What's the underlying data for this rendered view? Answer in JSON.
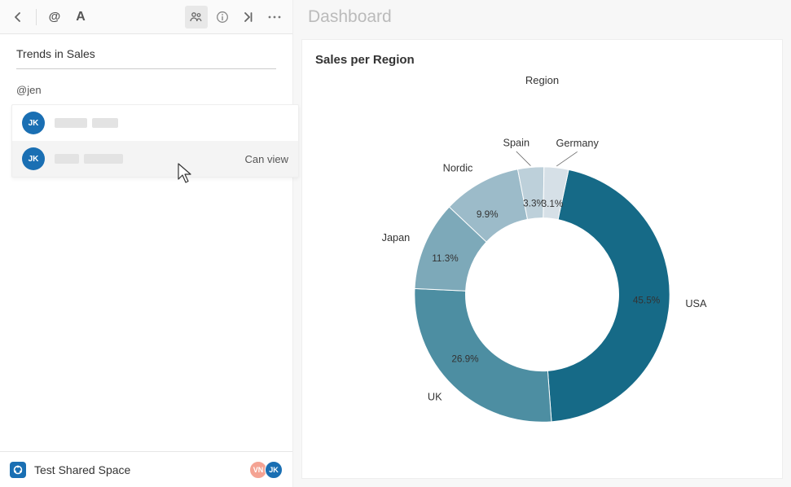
{
  "left": {
    "section_title": "Trends in Sales",
    "mention_text": "@jen",
    "suggestions": [
      {
        "initials": "JK",
        "permission": ""
      },
      {
        "initials": "JK",
        "permission": "Can view"
      }
    ]
  },
  "footer": {
    "space_name": "Test Shared Space",
    "avatars": [
      {
        "initials": "VN",
        "klass": "vn"
      },
      {
        "initials": "JK",
        "klass": "jk"
      }
    ]
  },
  "right": {
    "header": "Dashboard",
    "chart_title": "Sales per Region",
    "legend_title": "Region"
  },
  "chart_data": {
    "type": "pie",
    "title": "Sales per Region",
    "legend_title": "Region",
    "series": [
      {
        "name": "USA",
        "value": 45.5,
        "color": "#166a87"
      },
      {
        "name": "UK",
        "value": 26.9,
        "color": "#4d8ea2"
      },
      {
        "name": "Japan",
        "value": 11.3,
        "color": "#7da9b9"
      },
      {
        "name": "Nordic",
        "value": 9.9,
        "color": "#9cbbc9"
      },
      {
        "name": "Spain",
        "value": 3.3,
        "color": "#bdd0da"
      },
      {
        "name": "Germany",
        "value": 3.1,
        "color": "#d6e0e7"
      }
    ],
    "inner_radius_ratio": 0.6,
    "start_angle_offset_deg": 12
  }
}
